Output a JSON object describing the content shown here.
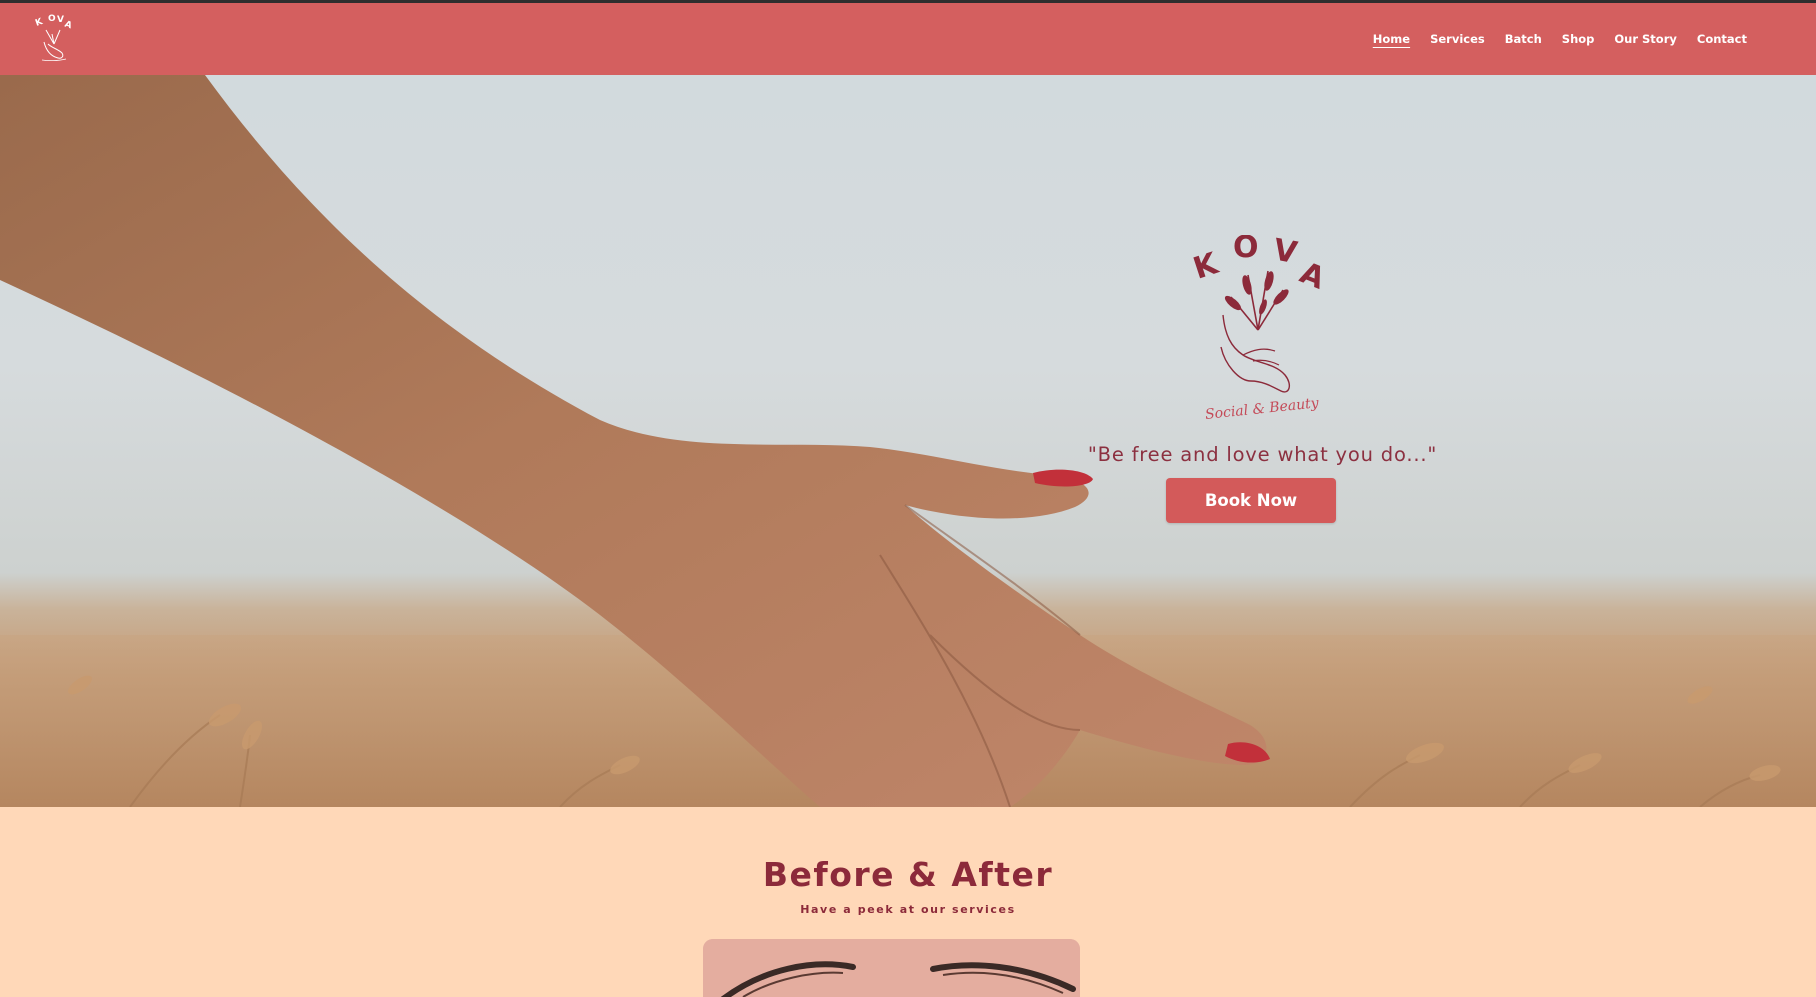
{
  "header": {
    "logo_icon": "kova-logo-small",
    "nav": [
      {
        "label": "Home",
        "active": true
      },
      {
        "label": "Services"
      },
      {
        "label": "Batch"
      },
      {
        "label": "Shop"
      },
      {
        "label": "Our Story"
      },
      {
        "label": "Contact"
      }
    ],
    "background": "#d45f5f"
  },
  "hero": {
    "logo": {
      "letters": [
        "K",
        "O",
        "V",
        "A"
      ],
      "script": "Social & Beauty",
      "icon": "hand-holding-flowers-logo"
    },
    "tagline": "\"Be free and love what you do...\"",
    "cta_label": "Book Now",
    "background_image": "hand-over-wheat-field-photo"
  },
  "before_after": {
    "title": "Before & After",
    "subtitle": "Have a peek at our services",
    "image": "eyebrow-closeup-photo"
  },
  "colors": {
    "accent": "#d45f5f",
    "text_brand": "#8c2a3a",
    "section_bg": "#ffd8b8"
  }
}
